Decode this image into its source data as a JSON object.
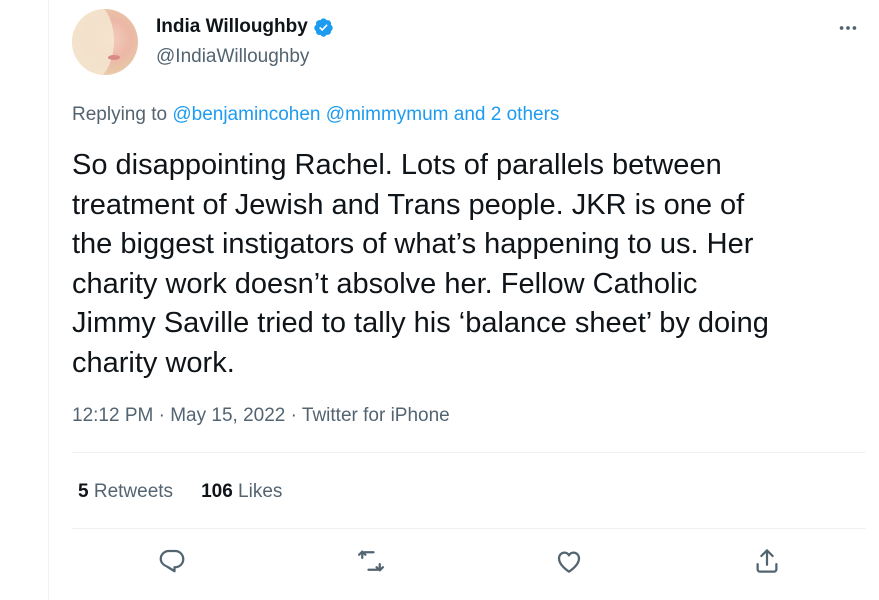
{
  "author": {
    "display_name": "India Willoughby",
    "handle": "@IndiaWilloughby"
  },
  "reply": {
    "prefix": "Replying to",
    "mentions": "@benjamincohen @mimmymum and 2 others"
  },
  "tweet": {
    "text": "So disappointing Rachel. Lots of parallels between\ntreatment of Jewish and Trans people. JKR is one of\nthe biggest instigators of what’s happening to us. Her\ncharity work doesn’t absolve her. Fellow Catholic\nJimmy Saville tried to tally his ‘balance sheet’ by doing\ncharity work.",
    "meta": "12:12 PM · May 15, 2022 · Twitter for iPhone"
  },
  "stats": {
    "retweets_count": "5",
    "retweets_label": "Retweets",
    "likes_count": "106",
    "likes_label": "Likes"
  },
  "icons": {
    "verified": "verified-badge-icon",
    "more": "more-icon",
    "reply": "reply-icon",
    "retweet": "retweet-icon",
    "like": "like-icon",
    "share": "share-icon"
  },
  "colors": {
    "accent": "#1d9bf0",
    "text": "#0f1419",
    "secondary": "#536471",
    "border": "#eff3f4"
  }
}
